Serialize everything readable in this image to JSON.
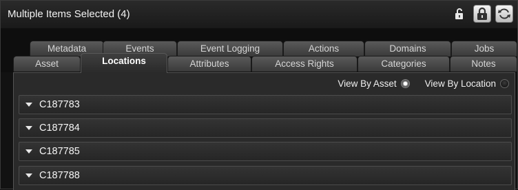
{
  "header": {
    "title": "Multiple Items Selected (4)"
  },
  "tabs_top": [
    {
      "label": "Metadata"
    },
    {
      "label": "Events"
    },
    {
      "label": "Event Logging"
    },
    {
      "label": "Actions"
    },
    {
      "label": "Domains"
    },
    {
      "label": "Jobs"
    }
  ],
  "tabs_bottom": [
    {
      "label": "Asset"
    },
    {
      "label": "Locations",
      "active": true
    },
    {
      "label": "Attributes"
    },
    {
      "label": "Access Rights"
    },
    {
      "label": "Categories"
    },
    {
      "label": "Notes"
    }
  ],
  "view": {
    "by_asset_label": "View By Asset",
    "by_location_label": "View By Location",
    "selected": "View By Asset"
  },
  "rows": [
    {
      "label": "C187783"
    },
    {
      "label": "C187784"
    },
    {
      "label": "C187785"
    },
    {
      "label": "C187788"
    }
  ],
  "colors": {
    "background": "#121212",
    "panel": "#2a2a2a",
    "text": "#f0f0f0"
  },
  "icons": [
    "unlock-icon",
    "lock-icon",
    "refresh-icon"
  ]
}
